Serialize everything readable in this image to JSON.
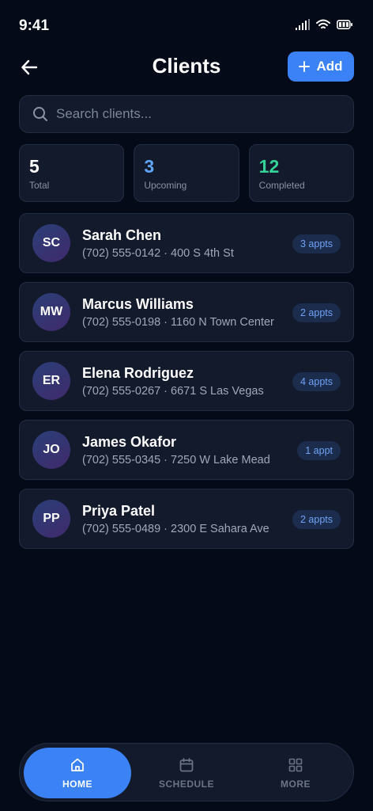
{
  "status_bar": {
    "time": "9:41"
  },
  "header": {
    "title": "Clients",
    "add_label": "Add"
  },
  "search": {
    "placeholder": "Search clients..."
  },
  "stats": [
    {
      "value": "5",
      "label": "Total",
      "color": "#ffffff"
    },
    {
      "value": "3",
      "label": "Upcoming",
      "color": "#60a5fa"
    },
    {
      "value": "12",
      "label": "Completed",
      "color": "#34d399"
    }
  ],
  "clients": [
    {
      "initials": "SC",
      "name": "Sarah Chen",
      "meta": "(702) 555-0142 · 400 S 4th St",
      "appts": "3 appts"
    },
    {
      "initials": "MW",
      "name": "Marcus Williams",
      "meta": "(702) 555-0198 · 1160 N Town Center",
      "appts": "2 appts"
    },
    {
      "initials": "ER",
      "name": "Elena Rodriguez",
      "meta": "(702) 555-0267 · 6671 S Las Vegas",
      "appts": "4 appts"
    },
    {
      "initials": "JO",
      "name": "James Okafor",
      "meta": "(702) 555-0345 · 7250 W Lake Mead",
      "appts": "1 appt"
    },
    {
      "initials": "PP",
      "name": "Priya Patel",
      "meta": "(702) 555-0489 · 2300 E Sahara Ave",
      "appts": "2 appts"
    }
  ],
  "nav": {
    "home": {
      "label": "HOME",
      "icon": "home-icon"
    },
    "schedule": {
      "label": "SCHEDULE",
      "icon": "calendar-icon"
    },
    "more": {
      "label": "MORE",
      "icon": "grid-icon"
    }
  },
  "colors": {
    "accent": "#3b82f6",
    "background": "#050a18",
    "card": "#121a2b"
  }
}
